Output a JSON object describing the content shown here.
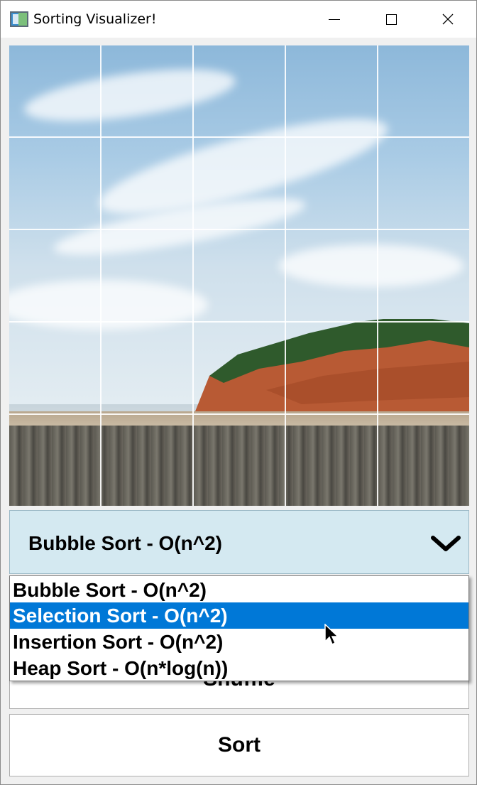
{
  "window": {
    "title": "Sorting Visualizer!",
    "controls": [
      "minimize",
      "maximize",
      "close"
    ]
  },
  "image": {
    "description_icon": "puzzle-image-grid",
    "grid": {
      "rows": 5,
      "cols": 5
    }
  },
  "algorithm_select": {
    "selected": "Bubble Sort - O(n^2)",
    "expanded": true,
    "arrow_icon": "chevron-down-icon",
    "background": "#d4e9f1",
    "options": [
      {
        "label": "Bubble Sort - O(n^2)",
        "highlighted": false
      },
      {
        "label": "Selection Sort - O(n^2)",
        "highlighted": true
      },
      {
        "label": "Insertion Sort - O(n^2)",
        "highlighted": false
      },
      {
        "label": "Heap Sort - O(n*log(n))",
        "highlighted": false
      }
    ],
    "highlight_color": "#0078d7"
  },
  "buttons": {
    "shuffle_label": "Shuffle",
    "sort_label": "Sort"
  }
}
